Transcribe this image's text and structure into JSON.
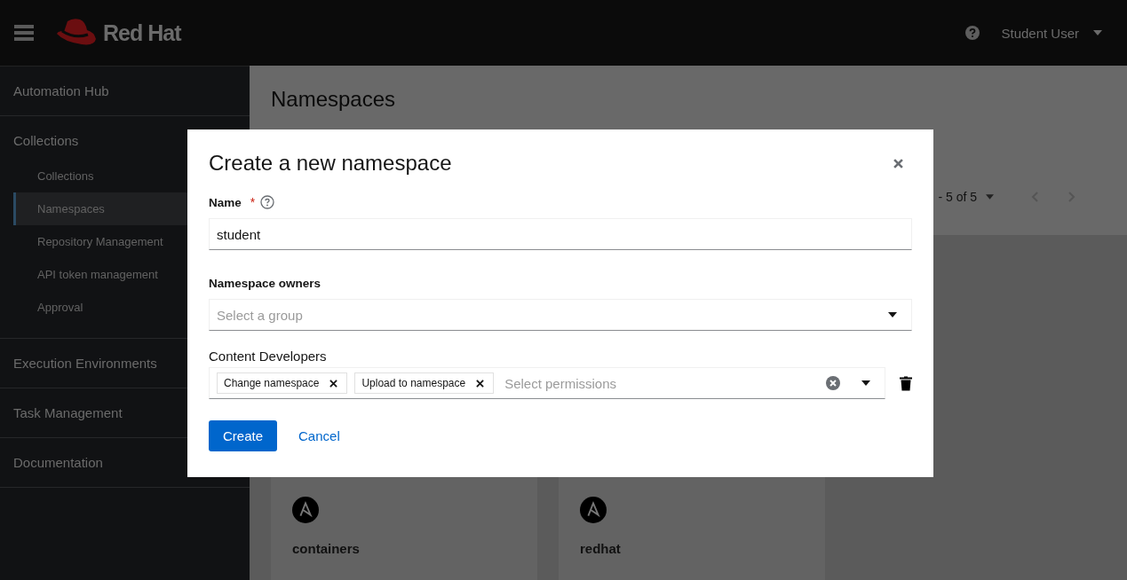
{
  "header": {
    "brand": "Red Hat",
    "user": "Student User"
  },
  "sidebar": {
    "items": [
      {
        "label": "Automation Hub",
        "selected": false
      },
      {
        "label": "Collections",
        "selected": false,
        "children": [
          {
            "label": "Collections",
            "selected": false
          },
          {
            "label": "Namespaces",
            "selected": true
          },
          {
            "label": "Repository Management",
            "selected": false
          },
          {
            "label": "API token management",
            "selected": false
          },
          {
            "label": "Approval",
            "selected": false
          }
        ]
      },
      {
        "label": "Execution Environments",
        "selected": false
      },
      {
        "label": "Task Management",
        "selected": false
      },
      {
        "label": "Documentation",
        "selected": false
      }
    ]
  },
  "page": {
    "title": "Namespaces",
    "pagination": "- 5 of 5",
    "cards": [
      {
        "name": "containers"
      },
      {
        "name": "redhat"
      }
    ]
  },
  "modal": {
    "title": "Create a new namespace",
    "name_field": {
      "label": "Name",
      "required": "*",
      "value": "student"
    },
    "owners_field": {
      "label": "Namespace owners",
      "placeholder": "Select a group"
    },
    "developers_field": {
      "label": "Content Developers",
      "chips": [
        "Change namespace",
        "Upload to namespace"
      ],
      "placeholder": "Select permissions"
    },
    "buttons": {
      "primary": "Create",
      "secondary": "Cancel"
    }
  }
}
